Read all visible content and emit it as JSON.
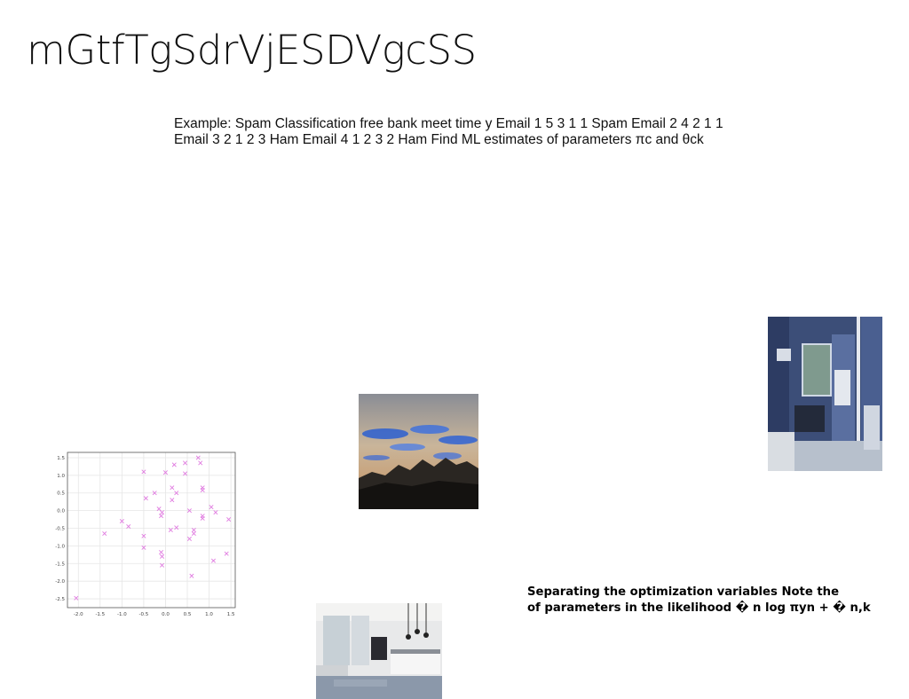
{
  "slide": {
    "title": "mGtfTgSdrVjESDVgcSS",
    "body_text": "Example: Spam Classification free bank meet time y Email 1 5 3 1 1 Spam Email 2 4 2 1 1 Email 3 2 1 2 3 Ham Email 4 1 2 3 2 Ham Find ML estimates of parameters πc and θck",
    "note_line1": "Separating the optimization variables Note the",
    "note_line2": "of parameters in the likelihood � n log πyn + � n,k"
  },
  "colors": {
    "scatter_marker": "#e07be0",
    "grid": "#e6e6e6"
  },
  "chart_data": {
    "type": "scatter",
    "marker": "x",
    "grid": true,
    "xlim": [
      -2.25,
      1.6
    ],
    "ylim": [
      -2.75,
      1.65
    ],
    "xticks": [
      "-2.0",
      "-1.5",
      "-1.0",
      "-0.5",
      "0.0",
      "0.5",
      "1.0",
      "1.5"
    ],
    "yticks": [
      "1.5",
      "1.0",
      "0.5",
      "0.0",
      "-0.5",
      "-1.0",
      "-1.5",
      "-2.0",
      "-2.5"
    ],
    "xtick_values": [
      -2.0,
      -1.5,
      -1.0,
      -0.5,
      0.0,
      0.5,
      1.0,
      1.5
    ],
    "ytick_values": [
      1.5,
      1.0,
      0.5,
      0.0,
      -0.5,
      -1.0,
      -1.5,
      -2.0,
      -2.5
    ],
    "points": [
      [
        -2.05,
        -2.48
      ],
      [
        -1.4,
        -0.65
      ],
      [
        -1.0,
        -0.3
      ],
      [
        -0.85,
        -0.45
      ],
      [
        -0.5,
        1.1
      ],
      [
        -0.45,
        0.35
      ],
      [
        -0.5,
        -0.72
      ],
      [
        -0.5,
        -1.05
      ],
      [
        -0.25,
        0.5
      ],
      [
        -0.15,
        0.05
      ],
      [
        -0.08,
        -0.05
      ],
      [
        -0.1,
        -0.15
      ],
      [
        -0.1,
        -1.18
      ],
      [
        -0.08,
        -1.3
      ],
      [
        -0.08,
        -1.55
      ],
      [
        0.0,
        1.08
      ],
      [
        0.15,
        0.65
      ],
      [
        0.2,
        1.3
      ],
      [
        0.15,
        0.3
      ],
      [
        0.25,
        0.5
      ],
      [
        0.12,
        -0.55
      ],
      [
        0.25,
        -0.48
      ],
      [
        0.45,
        1.05
      ],
      [
        0.45,
        1.35
      ],
      [
        0.55,
        0.0
      ],
      [
        0.55,
        -0.8
      ],
      [
        0.6,
        -1.85
      ],
      [
        0.65,
        -0.55
      ],
      [
        0.65,
        -0.65
      ],
      [
        0.75,
        1.5
      ],
      [
        0.8,
        1.35
      ],
      [
        0.85,
        0.65
      ],
      [
        0.85,
        0.58
      ],
      [
        0.85,
        -0.15
      ],
      [
        0.85,
        -0.22
      ],
      [
        1.05,
        0.1
      ],
      [
        1.1,
        -1.42
      ],
      [
        1.15,
        -0.05
      ],
      [
        1.4,
        -1.22
      ],
      [
        1.45,
        -0.25
      ]
    ]
  }
}
